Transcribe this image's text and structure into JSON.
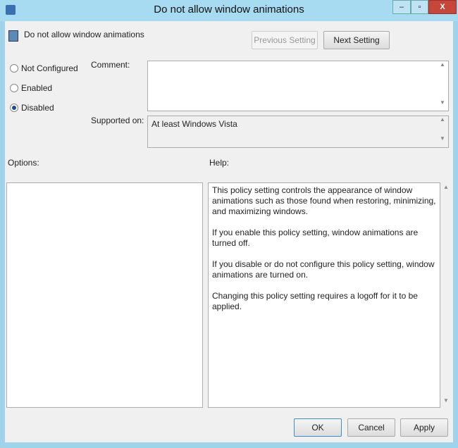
{
  "window": {
    "title": "Do not allow window animations",
    "minimize": "–",
    "maximize": "▫",
    "close": "X"
  },
  "header": {
    "policy_name": "Do not allow window animations",
    "previous_label": "Previous Setting",
    "next_label": "Next Setting"
  },
  "state": {
    "options": [
      "Not Configured",
      "Enabled",
      "Disabled"
    ],
    "selected": "Disabled"
  },
  "comment": {
    "label": "Comment:",
    "value": ""
  },
  "supported": {
    "label": "Supported on:",
    "value": "At least Windows Vista"
  },
  "options_label": "Options:",
  "help": {
    "label": "Help:",
    "paragraphs": [
      "This policy setting controls the appearance of window animations such as those found when restoring, minimizing, and maximizing windows.",
      "If you enable this policy setting, window animations are turned off.",
      "If you disable or do not configure this policy setting, window animations are turned on.",
      "Changing this policy setting requires a logoff for it to be applied."
    ]
  },
  "footer": {
    "ok": "OK",
    "cancel": "Cancel",
    "apply": "Apply"
  }
}
